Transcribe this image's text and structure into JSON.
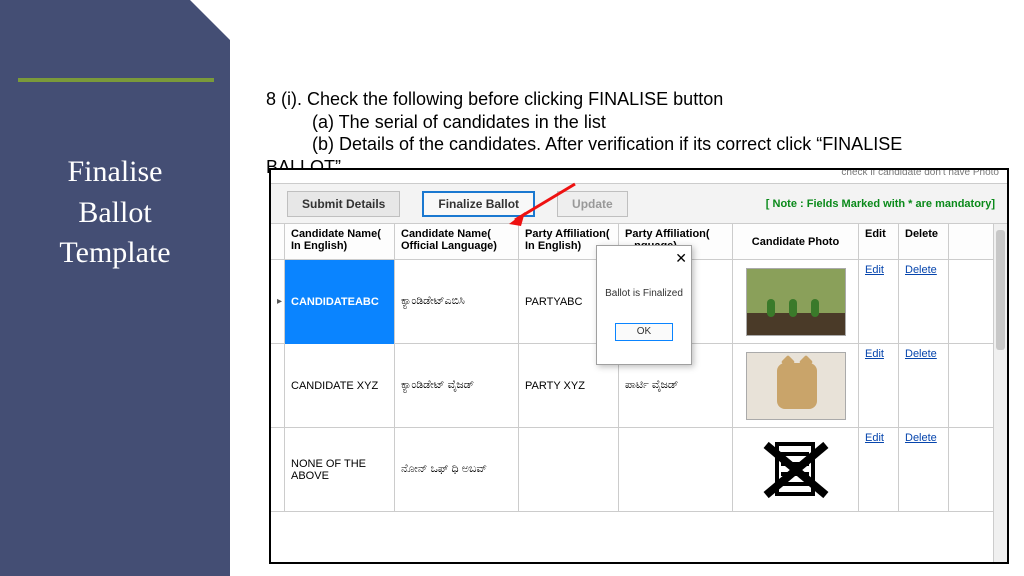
{
  "sidebar": {
    "title_line1": "Finalise",
    "title_line2": "Ballot",
    "title_line3": "Template"
  },
  "instructions": {
    "line1": "8 (i). Check the following before clicking FINALISE button",
    "line2": "(a) The serial of candidates in the list",
    "line3": "(b) Details of the candidates. After verification if its correct click “FINALISE",
    "line4": "BALLOT”"
  },
  "toolbar": {
    "submit": "Submit Details",
    "finalize": "Finalize Ballot",
    "update": "Update",
    "note": "[ Note : Fields Marked with * are mandatory]"
  },
  "photo_check": "check if candidate don't have Photo",
  "headers": {
    "name_en": "Candidate Name( In English)",
    "name_ol": "Candidate Name( Official Language)",
    "party_en": "Party Affiliation( In English)",
    "party_ol": "Party Affiliation( ...nguage)",
    "photo": "Candidate Photo",
    "edit": "Edit",
    "delete": "Delete"
  },
  "rows": [
    {
      "marker": "▸",
      "name_en": "CANDIDATEABC",
      "name_ol": "ಕ್ಯಾಂಡಿಡೇಟ್‌ಎಬಿಸಿ",
      "party_en": "PARTYABC",
      "party_ol": "",
      "edit": "Edit",
      "delete": "Delete"
    },
    {
      "marker": "",
      "name_en": "CANDIDATE XYZ",
      "name_ol": "ಕ್ಯಾಂಡಿಡೇಟ್ ವೈಜಡ್",
      "party_en": "PARTY XYZ",
      "party_ol": "ಪಾರ್ಟಿ ವೈಜಡ್",
      "edit": "Edit",
      "delete": "Delete"
    },
    {
      "marker": "",
      "name_en": "NONE OF THE ABOVE",
      "name_ol": "ನೋನ್ ಒಫ್ ಧಿ ಅಬವ್",
      "party_en": "",
      "party_ol": "",
      "edit": "Edit",
      "delete": "Delete"
    }
  ],
  "modal": {
    "message": "Ballot is Finalized",
    "ok": "OK",
    "close": "✕"
  }
}
